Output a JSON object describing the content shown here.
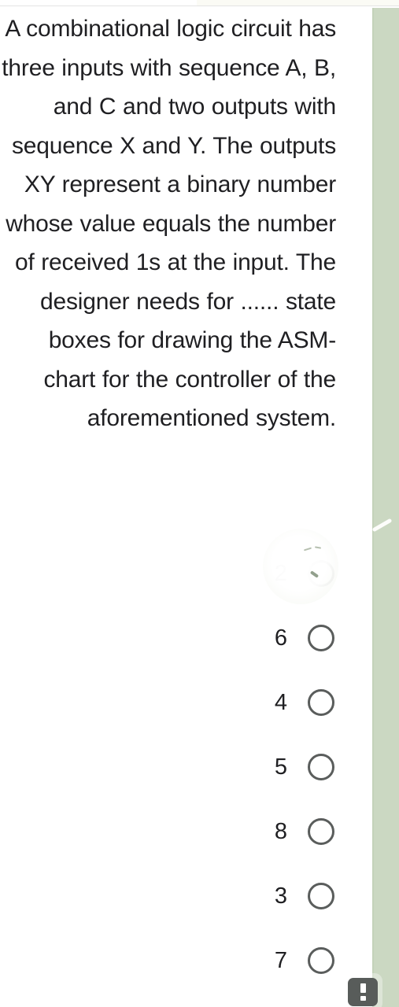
{
  "page": {
    "background_color": "#ffffff",
    "text_color": "#1f1f22"
  },
  "sidebar": {
    "name": "green-margin-panel",
    "color": "#cbd8c2"
  },
  "question": {
    "text": "A combinational logic circuit has three inputs with sequence A, B, and C and two outputs with sequence X and Y. The outputs XY represent a binary number whose value equals the number of received 1s at the input. The designer needs for ...... state boxes for drawing the ASM-chart for the controller of the aforementioned system."
  },
  "options": [
    {
      "label": "2",
      "selected": false,
      "obscured": true
    },
    {
      "label": "6",
      "selected": false,
      "obscured": false
    },
    {
      "label": "4",
      "selected": false,
      "obscured": false
    },
    {
      "label": "5",
      "selected": false,
      "obscured": false
    },
    {
      "label": "8",
      "selected": false,
      "obscured": false
    },
    {
      "label": "3",
      "selected": false,
      "obscured": false
    },
    {
      "label": "7",
      "selected": false,
      "obscured": false
    }
  ],
  "fab": {
    "icon": "exclamation-icon",
    "color": "#585c5a"
  }
}
